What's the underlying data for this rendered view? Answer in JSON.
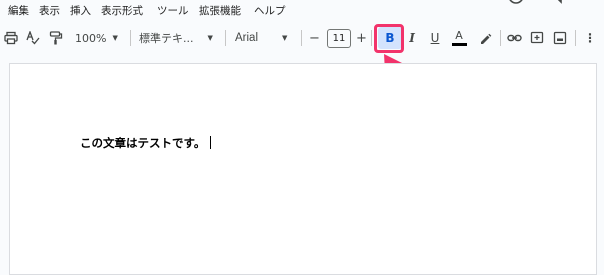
{
  "menu": {
    "items": [
      "編集",
      "表示",
      "挿入",
      "表示形式",
      "ツール",
      "拡張機能",
      "ヘルプ"
    ]
  },
  "toolbar": {
    "zoom": "100%",
    "style": "標準テキ...",
    "font": "Arial",
    "font_size": "11",
    "minus": "−",
    "plus": "+",
    "bold": "B",
    "italic": "I",
    "underline": "U",
    "text_color_label": "A",
    "more": "⋮"
  },
  "document": {
    "text": "この文章はテストです。"
  },
  "colors": {
    "highlight": "#f2336b",
    "bold_active_bg": "#d3e3fd",
    "bold_active_text": "#0b57d0"
  },
  "icons": [
    "print-icon",
    "spellcheck-icon",
    "paint-format-icon",
    "pen-icon",
    "link-icon",
    "add-comment-icon",
    "image-icon",
    "more-icon"
  ]
}
